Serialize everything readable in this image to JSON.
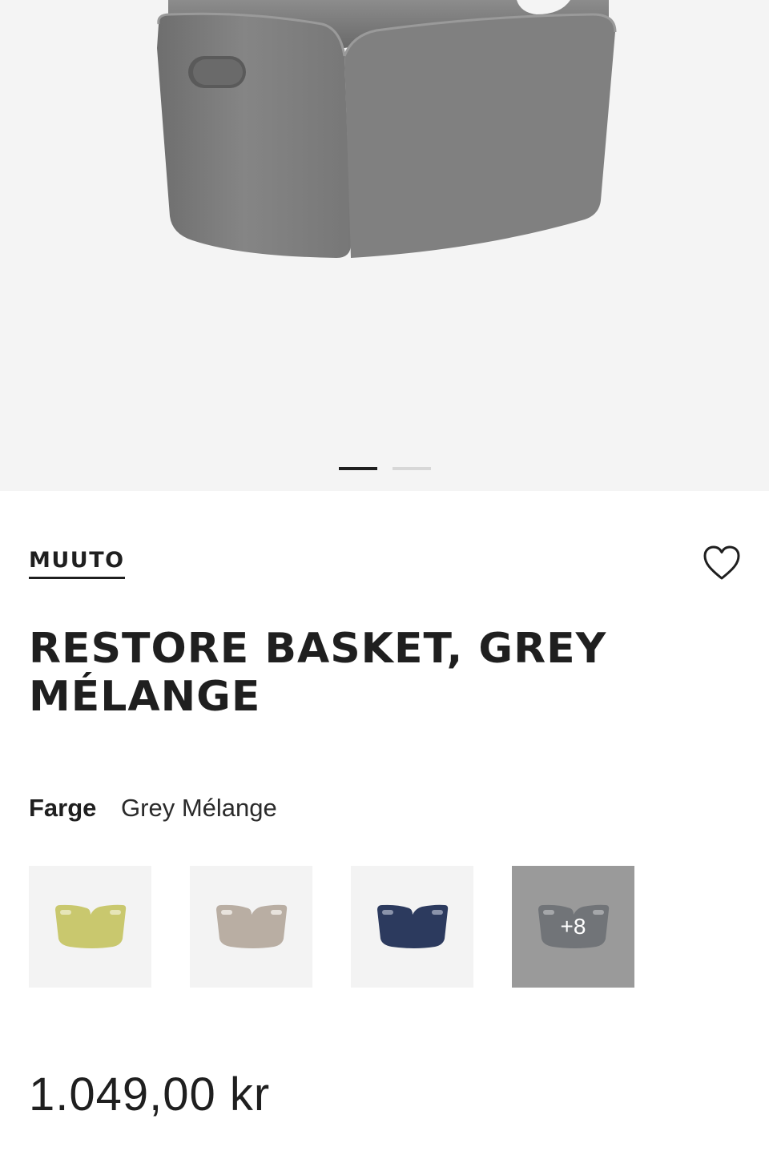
{
  "gallery": {
    "slide_count": 2,
    "active_slide": 1
  },
  "product": {
    "brand": "MUUTO",
    "title": "RESTORE BASKET, GREY MÉLANGE",
    "color_label": "Farge",
    "color_value": "Grey Mélange",
    "price": "1.049,00 kr"
  },
  "swatches": {
    "items": [
      {
        "name": "olive",
        "color": "#c9c86e"
      },
      {
        "name": "sand",
        "color": "#b9aea3"
      },
      {
        "name": "navy",
        "color": "#2c3a5e"
      }
    ],
    "more_label": "+8",
    "more_color": "#717478"
  },
  "icons": {
    "favorite": "heart-outline-icon"
  },
  "colors": {
    "text": "#1f1f1f",
    "hero_bg": "#f4f4f4",
    "basket": "#7d7d7d"
  }
}
